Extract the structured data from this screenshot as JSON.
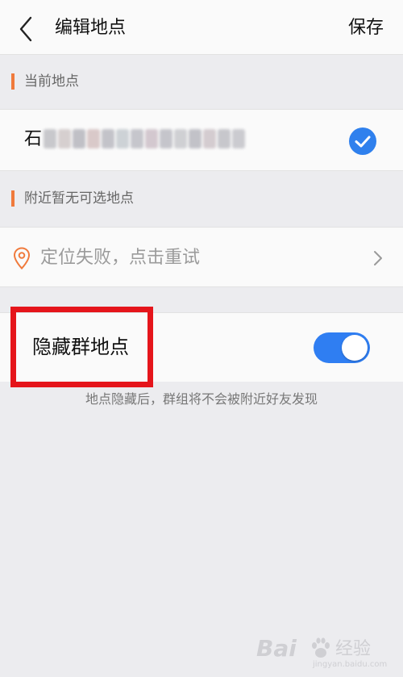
{
  "header": {
    "title": "编辑地点",
    "save_label": "保存"
  },
  "current_section": {
    "label": "当前地点",
    "location_prefix": "石",
    "location_selected": true
  },
  "nearby_section": {
    "label": "附近暂无可选地点",
    "retry_text": "定位失败，点击重试"
  },
  "hide_setting": {
    "label": "隐藏群地点",
    "enabled": true,
    "hint": "地点隐藏后，群组将不会被附近好友发现"
  },
  "watermark": {
    "brand": "Bai",
    "name": "经验",
    "url": "jingyan.baidu.com"
  },
  "colors": {
    "accent_bar": "#f07a3c",
    "toggle_on": "#2f7ef2",
    "check": "#2f80ed",
    "highlight": "#e5151b"
  }
}
